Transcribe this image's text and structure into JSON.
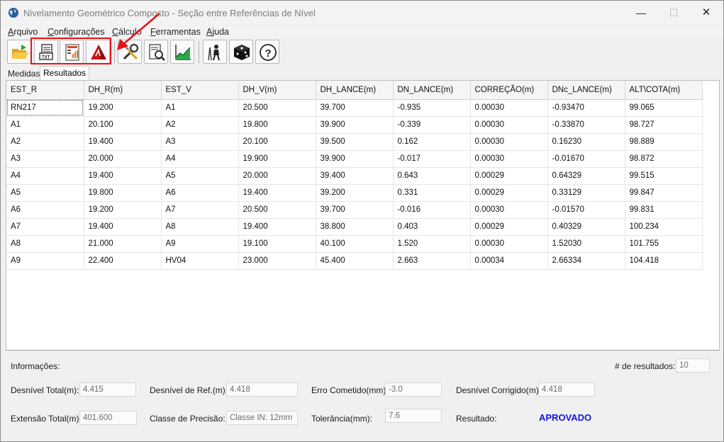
{
  "window": {
    "title": "Nivelamento Geométrico Composto - Seção entre Referências de Nível",
    "minimize": "—",
    "maximize": "☐",
    "close": "✕"
  },
  "menu": [
    "Arquivo",
    "Configurações",
    "Cálculo",
    "Ferramentas",
    "Ajuda"
  ],
  "toolbar": {
    "buttons": [
      {
        "icon": "open-folder-icon"
      },
      {
        "icon": "export-txt-icon",
        "text": "TXT"
      },
      {
        "icon": "report-icon"
      },
      {
        "icon": "autocad-icon"
      },
      {
        "icon": "tools-icon"
      },
      {
        "icon": "search-document-icon"
      },
      {
        "icon": "chart-icon"
      },
      {
        "icon": "surveyor-icon"
      },
      {
        "icon": "dice-icon"
      },
      {
        "icon": "help-icon",
        "text": "?"
      }
    ],
    "highlight_color": "#e0161b"
  },
  "tabs": {
    "medidas": "Medidas",
    "resultados": "Resultados"
  },
  "table": {
    "headers": [
      "EST_R",
      "DH_R(m)",
      "EST_V",
      "DH_V(m)",
      "DH_LANCE(m)",
      "DN_LANCE(m)",
      "CORREÇÃO(m)",
      "DNc_LANCE(m)",
      "ALT\\COTA(m)"
    ],
    "rows": [
      [
        "RN217",
        "19.200",
        "A1",
        "20.500",
        "39.700",
        "-0.935",
        "0.00030",
        "-0.93470",
        "99.065"
      ],
      [
        "A1",
        "20.100",
        "A2",
        "19.800",
        "39.900",
        "-0.339",
        "0.00030",
        "-0.33870",
        "98.727"
      ],
      [
        "A2",
        "19.400",
        "A3",
        "20.100",
        "39.500",
        "0.162",
        "0.00030",
        "0.16230",
        "98.889"
      ],
      [
        "A3",
        "20.000",
        "A4",
        "19.900",
        "39.900",
        "-0.017",
        "0.00030",
        "-0.01670",
        "98.872"
      ],
      [
        "A4",
        "19.400",
        "A5",
        "20.000",
        "39.400",
        "0.643",
        "0.00029",
        "0.64329",
        "99.515"
      ],
      [
        "A5",
        "19.800",
        "A6",
        "19.400",
        "39.200",
        "0.331",
        "0.00029",
        "0.33129",
        "99.847"
      ],
      [
        "A6",
        "19.200",
        "A7",
        "20.500",
        "39.700",
        "-0.016",
        "0.00030",
        "-0.01570",
        "99.831"
      ],
      [
        "A7",
        "19.400",
        "A8",
        "19.400",
        "38.800",
        "0.403",
        "0.00029",
        "0.40329",
        "100.234"
      ],
      [
        "A8",
        "21.000",
        "A9",
        "19.100",
        "40.100",
        "1.520",
        "0.00030",
        "1.52030",
        "101.755"
      ],
      [
        "A9",
        "22.400",
        "HV04",
        "23.000",
        "45.400",
        "2.663",
        "0.00034",
        "2.66334",
        "104.418"
      ]
    ]
  },
  "info": {
    "title": "Informações:",
    "num_results_label": "# de resultados:",
    "num_results": "10",
    "desnivel_total_label": "Desnível Total(m):",
    "desnivel_total": "4.415",
    "desnivel_ref_label": "Desnível de Ref.(m):",
    "desnivel_ref": "4.418",
    "erro_label": "Erro Cometido(mm):",
    "erro": "-3.0",
    "desnivel_corrigido_label": "Desnível Corrigido(m):",
    "desnivel_corrigido": "4.418",
    "extensao_label": "Extensão Total(m):",
    "extensao": "401.600",
    "classe_label": "Classe de Precisão:",
    "classe": "Classe IN: 12mm",
    "tolerancia_label": "Tolerância(mm):",
    "tolerancia": "7.6",
    "resultado_label": "Resultado:",
    "resultado": "APROVADO",
    "resultado_color": "#1515e0"
  }
}
